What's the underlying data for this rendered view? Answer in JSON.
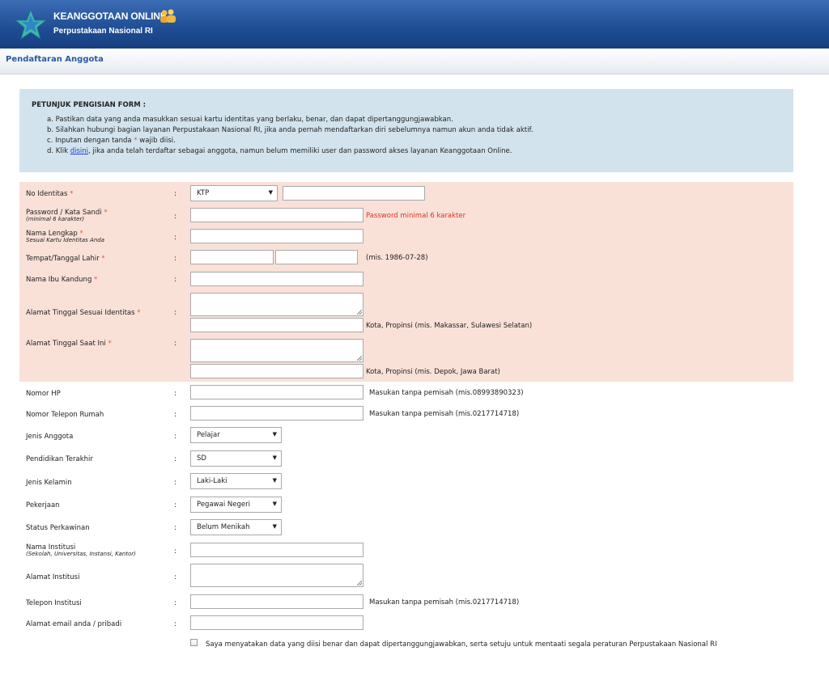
{
  "header": {
    "app_title": "KEANGGOTAAN ONLINE",
    "subtitle": "Perpustakaan Nasional RI",
    "logo_icon": "star-logo-icon",
    "members_icon": "people-icon"
  },
  "page": {
    "title": "Pendaftaran Anggota"
  },
  "instructions": {
    "heading": "PETUNJUK PENGISIAN FORM :",
    "a": "a. Pastikan data yang anda masukkan sesuai kartu identitas yang berlaku, benar, dan dapat dipertanggungjawabkan.",
    "b": "b. Silahkan hubungi bagian layanan Perpustakaan Nasional RI, jika anda pernah mendaftarkan diri sebelumnya namun akun anda tidak aktif.",
    "c_pre": "c. Inputan dengan tanda",
    "c_star": "*",
    "c_post": "wajib diisi.",
    "d_pre": "d. Klik",
    "d_link": "disini",
    "d_post": ", jika anda telah terdaftar sebagai anggota, namun belum memiliki user dan password akses layanan Keanggotaan Online."
  },
  "form": {
    "colon": ":",
    "required_mark": "*",
    "no_identitas": {
      "label": "No Identitas",
      "type_value": "KTP",
      "value": ""
    },
    "password": {
      "label": "Password / Kata Sandi",
      "sub": "(minimal 6 karakter)",
      "value": "",
      "error": "Password minimal 6 karakter"
    },
    "nama_lengkap": {
      "label": "Nama Lengkap",
      "sub": "Sesuai Kartu Identitas Anda",
      "value": ""
    },
    "ttl": {
      "label": "Tempat/Tanggal Lahir",
      "hint": "(mis. 1986-07-28)",
      "place": "",
      "date": ""
    },
    "ibu": {
      "label": "Nama Ibu Kandung",
      "value": ""
    },
    "alamat_identitas": {
      "label": "Alamat Tinggal Sesuai Identitas",
      "hint": "Kota, Propinsi (mis. Makassar, Sulawesi Selatan)"
    },
    "alamat_kini": {
      "label": "Alamat Tinggal Saat Ini",
      "hint": "Kota, Propinsi (mis. Depok, Jawa Barat)"
    },
    "hp": {
      "label": "Nomor HP",
      "hint": "Masukan tanpa pemisah (mis.08993890323)"
    },
    "telp_rumah": {
      "label": "Nomor Telepon Rumah",
      "hint": "Masukan tanpa pemisah (mis.0217714718)"
    },
    "jenis_anggota": {
      "label": "Jenis Anggota",
      "value": "Pelajar"
    },
    "pendidikan": {
      "label": "Pendidikan Terakhir",
      "value": "SD"
    },
    "kelamin": {
      "label": "Jenis Kelamin",
      "value": "Laki-Laki"
    },
    "pekerjaan": {
      "label": "Pekerjaan",
      "value": "Pegawai Negeri"
    },
    "perkawinan": {
      "label": "Status Perkawinan",
      "value": "Belum Menikah"
    },
    "institusi": {
      "label": "Nama Institusi",
      "sub": "(Sekolah, Universitas, Instansi, Kantor)"
    },
    "alamat_institusi": {
      "label": "Alamat Institusi"
    },
    "telp_institusi": {
      "label": "Telepon Institusi",
      "hint": "Masukan tanpa pemisah (mis.0217714718)"
    },
    "email": {
      "label": "Alamat email anda / pribadi"
    },
    "agreement": "Saya menyatakan data yang diisi benar dan dapat dipertanggungjawabkan, serta setuju untuk mentaati segala peraturan Perpustakaan Nasional RI",
    "dropdown_icon": "dropdown-arrow-icon"
  }
}
